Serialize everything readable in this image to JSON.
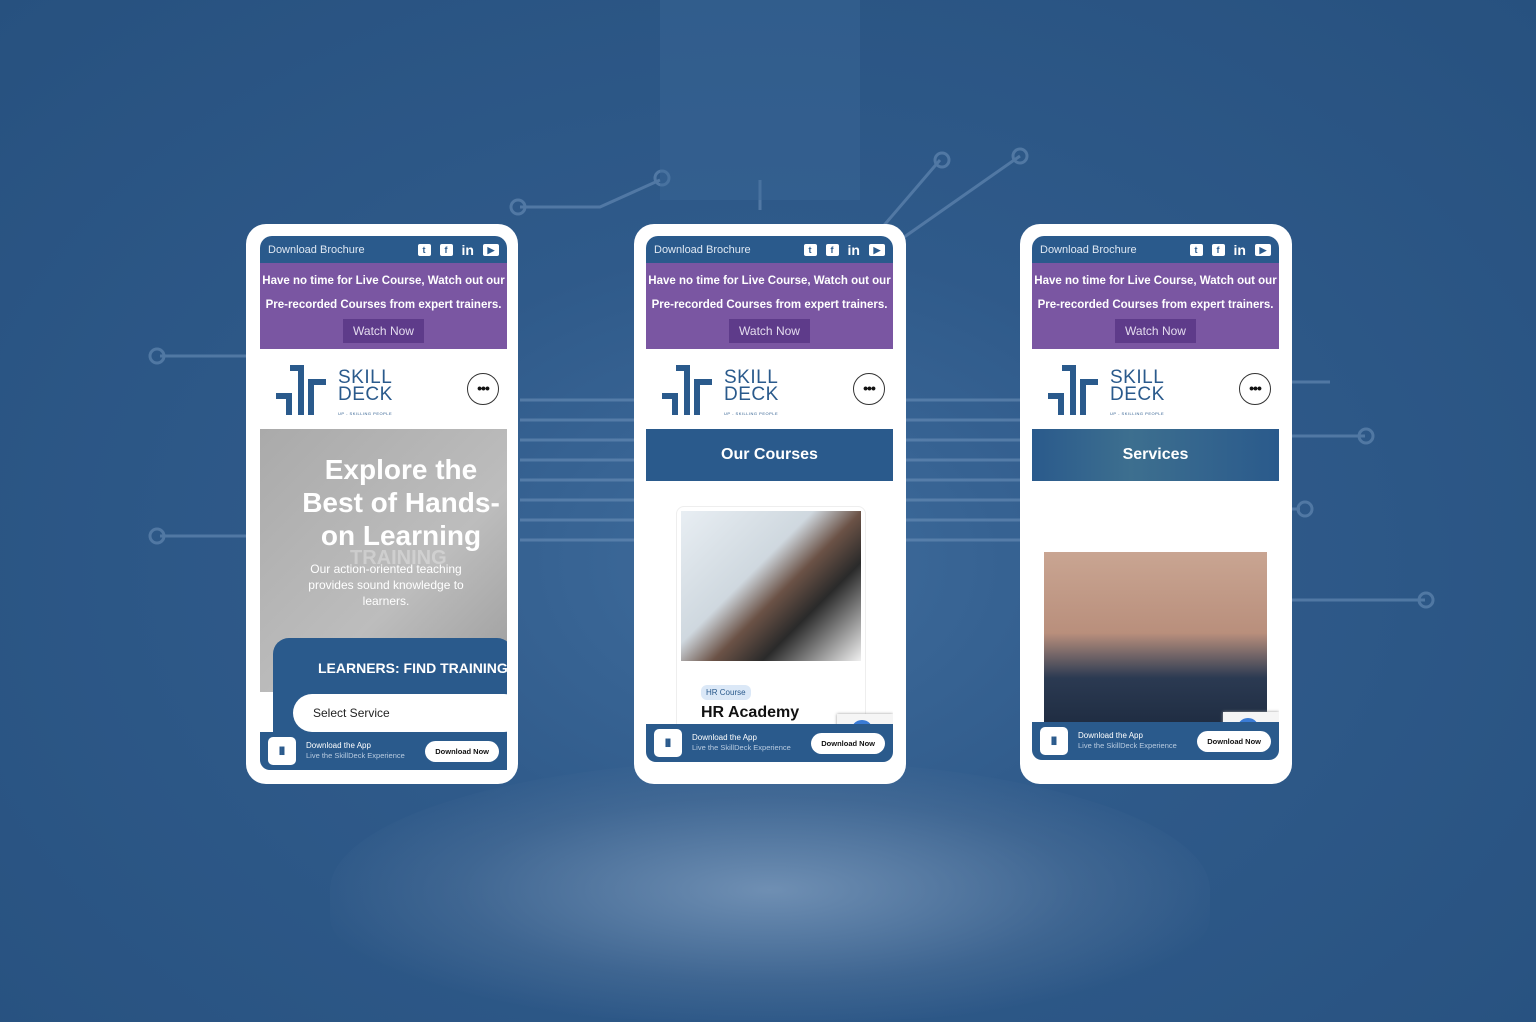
{
  "common": {
    "download_brochure": "Download Brochure",
    "promo_line1": "Have no time for Live Course, Watch out our",
    "promo_line2": "Pre-recorded Courses from expert trainers.",
    "watch_now": "Watch Now",
    "logo_top": "SKILL",
    "logo_bottom": "DECK",
    "logo_tagline": "UP - SKILLING PEOPLE",
    "menu_icon": "•••",
    "app_title": "Download the App",
    "app_subtitle": "Live the SkillDeck Experience",
    "download_now": "Download Now",
    "social_icons": [
      "twitter-icon",
      "facebook-icon",
      "linkedin-icon",
      "youtube-icon"
    ]
  },
  "phone1": {
    "hero_title": "Explore the Best of Hands-on Learning",
    "hero_watermark": "TRAINING",
    "hero_text": "Our action-oriented teaching provides sound knowledge to learners.",
    "find_title": "LEARNERS: FIND TRAININGS",
    "select_placeholder": "Select Service"
  },
  "phone2": {
    "banner": "Our Courses",
    "course_tag": "HR Course",
    "course_title": "HR Academy"
  },
  "phone3": {
    "banner": "Services"
  },
  "colors": {
    "brand_blue": "#2a5a8c",
    "promo_purple": "#7a56a2",
    "watch_button": "#5e3b8a",
    "background": "#2f5a8a"
  }
}
